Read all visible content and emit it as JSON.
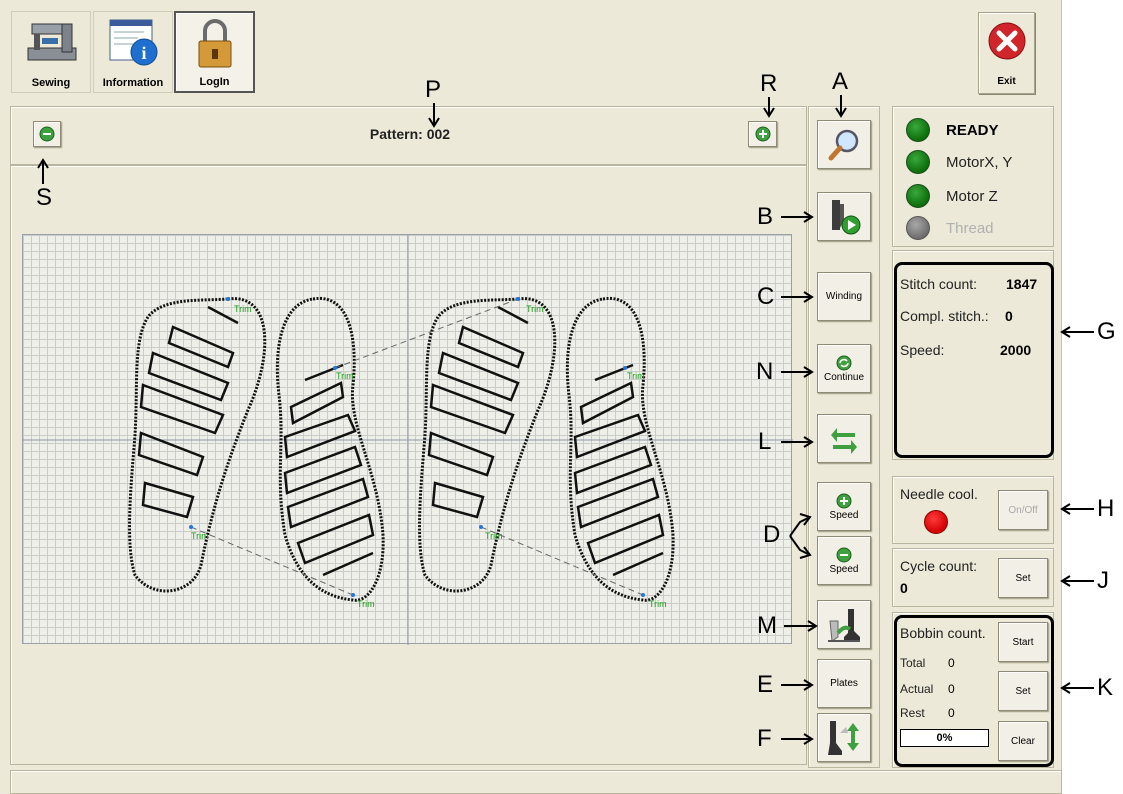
{
  "toolbar": {
    "sewing_label": "Sewing",
    "information_label": "Information",
    "login_label": "LogIn",
    "exit_label": "Exit"
  },
  "pattern": {
    "label": "Pattern: 002"
  },
  "sidebar": {
    "winding_label": "Winding",
    "continue_label": "Continue",
    "speed_up_label": "Speed",
    "speed_down_label": "Speed",
    "plates_label": "Plates"
  },
  "status": {
    "ready": "READY",
    "motor_xy": "MotorX, Y",
    "motor_z": "Motor Z",
    "thread": "Thread"
  },
  "stitch": {
    "count_label": "Stitch count:",
    "count_value": "1847",
    "compl_label": "Compl. stitch.:",
    "compl_value": "0",
    "speed_label": "Speed:",
    "speed_value": "2000"
  },
  "needle": {
    "label": "Needle cool.",
    "onoff_label": "On/Off"
  },
  "cycle": {
    "label": "Cycle count:",
    "value": "0",
    "set_label": "Set"
  },
  "bobbin": {
    "label": "Bobbin count.",
    "start_label": "Start",
    "set_label": "Set",
    "clear_label": "Clear",
    "total_label": "Total",
    "total_value": "0",
    "actual_label": "Actual",
    "actual_value": "0",
    "rest_label": "Rest",
    "rest_value": "0",
    "progress": "0%"
  },
  "pattern_view": {
    "trim_label": "Trim"
  },
  "annotations": {
    "A": "A",
    "B": "B",
    "C": "C",
    "D": "D",
    "E": "E",
    "F": "F",
    "G": "G",
    "H": "H",
    "J": "J",
    "K": "K",
    "L": "L",
    "M": "M",
    "N": "N",
    "P": "P",
    "R": "R",
    "S": "S"
  },
  "colors": {
    "led_green": "#0b6f0b",
    "led_gray": "#6e6e6e",
    "needle_red": "#e00000",
    "trim_green": "#1a9a1a",
    "stitch": "#111111"
  }
}
